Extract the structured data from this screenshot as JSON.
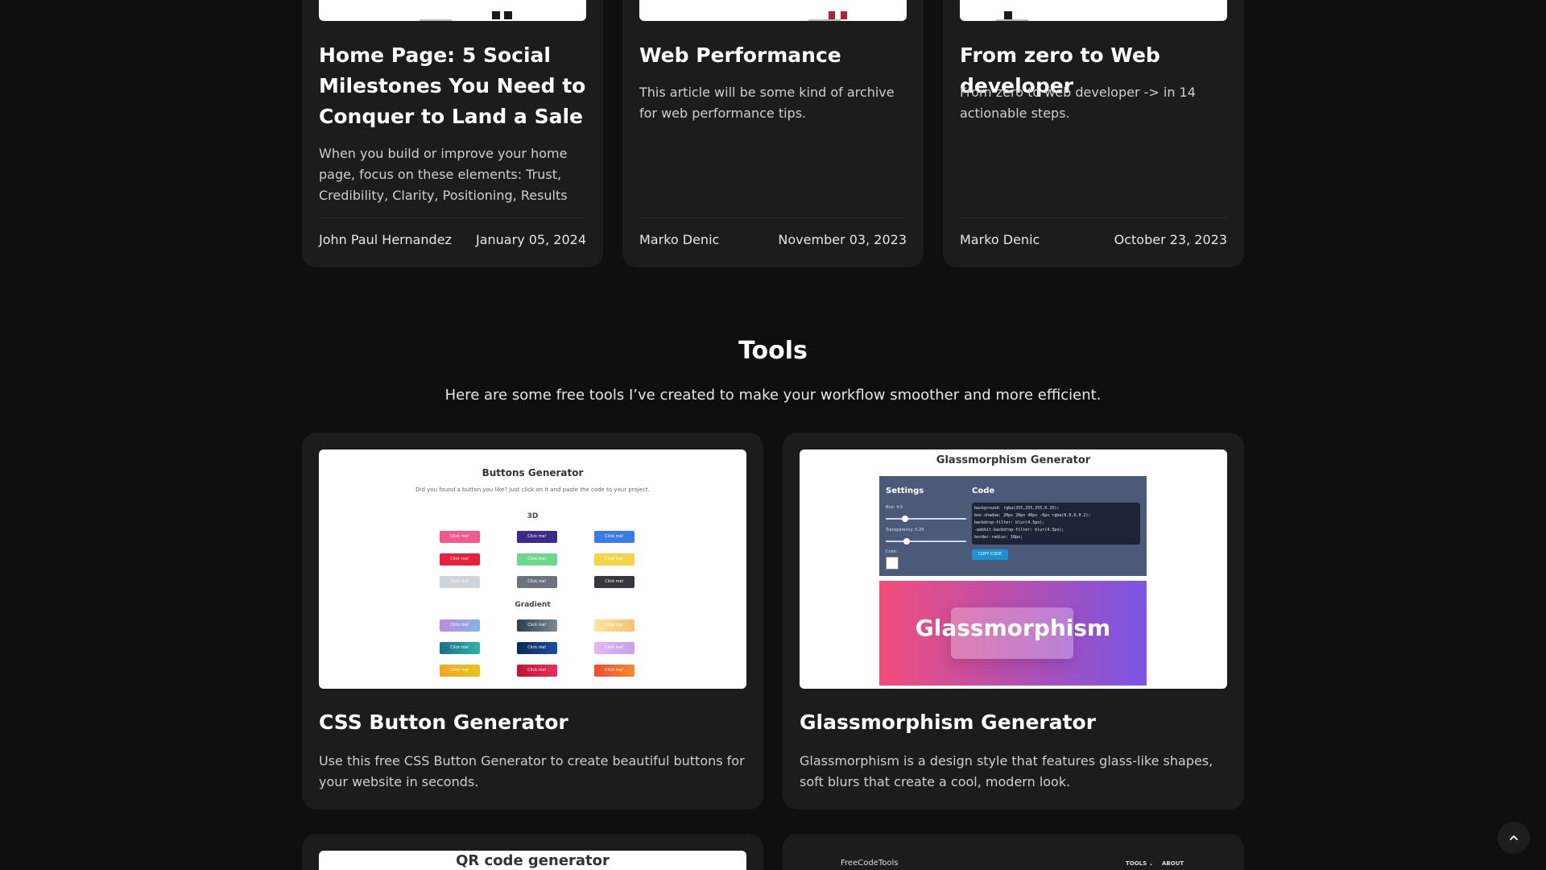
{
  "articles": [
    {
      "title": "Home Page: 5 Social Milestones You Need to Conquer to Land a Sale",
      "description": "When you build or improve your home page, focus on these elements: Trust, Credibility, Clarity, Positioning, Results",
      "author": "John Paul Hernandez",
      "date": "January 05, 2024"
    },
    {
      "title": "Web Performance",
      "description": "This article will be some kind of archive for web performance tips.",
      "author": "Marko Denic",
      "date": "November 03, 2023"
    },
    {
      "title": "From zero to Web developer",
      "description": "From zero to web developer -> in 14 actionable steps.",
      "author": "Marko Denic",
      "date": "October 23, 2023"
    }
  ],
  "tools": {
    "title": "Tools",
    "subtitle": "Here are some free tools I’ve created to make your workflow smoother and more efficient.",
    "items": [
      {
        "title": "CSS Button Generator",
        "description": "Use this free CSS Button Generator to create beautiful buttons for your website in seconds.",
        "preview": {
          "heading": "Buttons Generator",
          "subheading": "Did you found a button you like? Just click on it and paste the code to your project.",
          "section_3d": "3D",
          "section_gradient": "Gradient",
          "button_label": "Click me!"
        }
      },
      {
        "title": "Glassmorphism Generator",
        "description": "Glassmorphism is a design style that features glass-like shapes, soft blurs that create a cool, modern look.",
        "preview": {
          "heading": "Glassmorphism Generator",
          "settings_label": "Settings",
          "code_label": "Code",
          "blur_label": "Blur: 4.5",
          "transparency_label": "Transparency: 0.25",
          "color_label": "Color:",
          "code_text": "background: rgba(255,255,255,0.25);\nbox-shadow: 20px 20px 40px -6px rgba(0,0,0,0.2);\nbackdrop-filter: blur(4.5px);\n-webkit-backdrop-filter: blur(4.5px);\nborder-radius: 10px;",
          "copy_button": "COPY CODE",
          "hero_text": "Glassmorphism"
        }
      },
      {
        "preview": {
          "heading": "QR code generator"
        }
      },
      {
        "preview": {
          "logo": "FreeCodeTools",
          "nav_tools": "TOOLS ⌄",
          "nav_about": "ABOUT"
        }
      }
    ]
  },
  "colors": {
    "background": "#0f0f0f",
    "card": "#1c1c1c",
    "hero_gradient_start": "#f24d7a",
    "hero_gradient_end": "#7a55e6"
  },
  "icons": {
    "scroll_top": "chevron-up-icon"
  }
}
